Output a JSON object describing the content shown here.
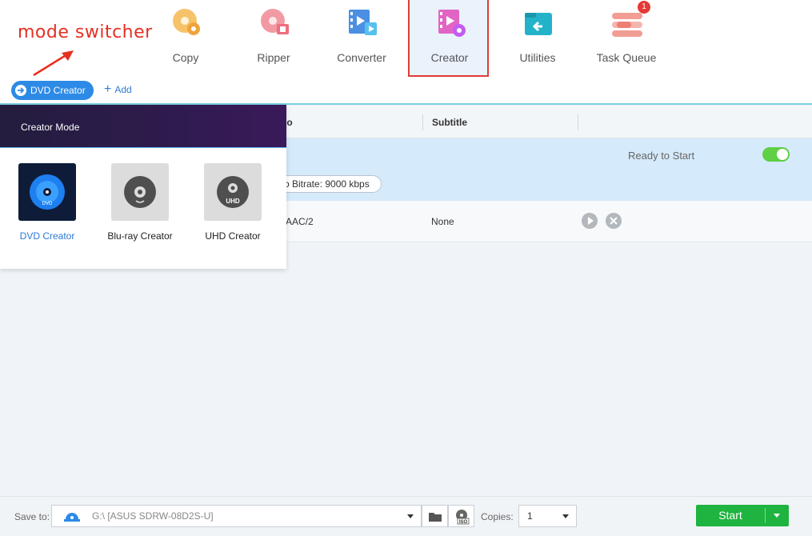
{
  "annotation": {
    "text": "mode switcher"
  },
  "nav": {
    "items": [
      {
        "label": "Copy",
        "icon": "disc-copy-icon"
      },
      {
        "label": "Ripper",
        "icon": "disc-ripper-icon"
      },
      {
        "label": "Converter",
        "icon": "film-converter-icon"
      },
      {
        "label": "Creator",
        "icon": "creator-icon",
        "active": true
      },
      {
        "label": "Utilities",
        "icon": "toolbox-icon"
      },
      {
        "label": "Task Queue",
        "icon": "task-queue-icon",
        "badge": "1"
      }
    ]
  },
  "toolbar": {
    "mode_label": "DVD Creator",
    "add_label": "Add"
  },
  "table": {
    "headers": {
      "audio_partial": "io",
      "subtitle": "Subtitle"
    },
    "rows": [
      {
        "status": "Ready to Start",
        "bitrate": "o Bitrate: 9000 kbps"
      },
      {
        "audio": "AAC/2",
        "subtitle": "None"
      }
    ]
  },
  "creator_popup": {
    "title": "Creator Mode",
    "options": [
      {
        "label": "DVD Creator",
        "selected": true,
        "disc_text": "DVD"
      },
      {
        "label": "Blu-ray Creator",
        "selected": false
      },
      {
        "label": "UHD Creator",
        "selected": false,
        "disc_text": "UHD"
      }
    ]
  },
  "bottom": {
    "save_to_label": "Save to:",
    "save_to_value": "G:\\ [ASUS SDRW-08D2S-U]",
    "copies_label": "Copies:",
    "copies_value": "1",
    "start_label": "Start"
  },
  "colors": {
    "accent": "#2d8ae6",
    "start": "#1eb43f",
    "annotation": "#e53022",
    "active_border": "#e03b36"
  }
}
